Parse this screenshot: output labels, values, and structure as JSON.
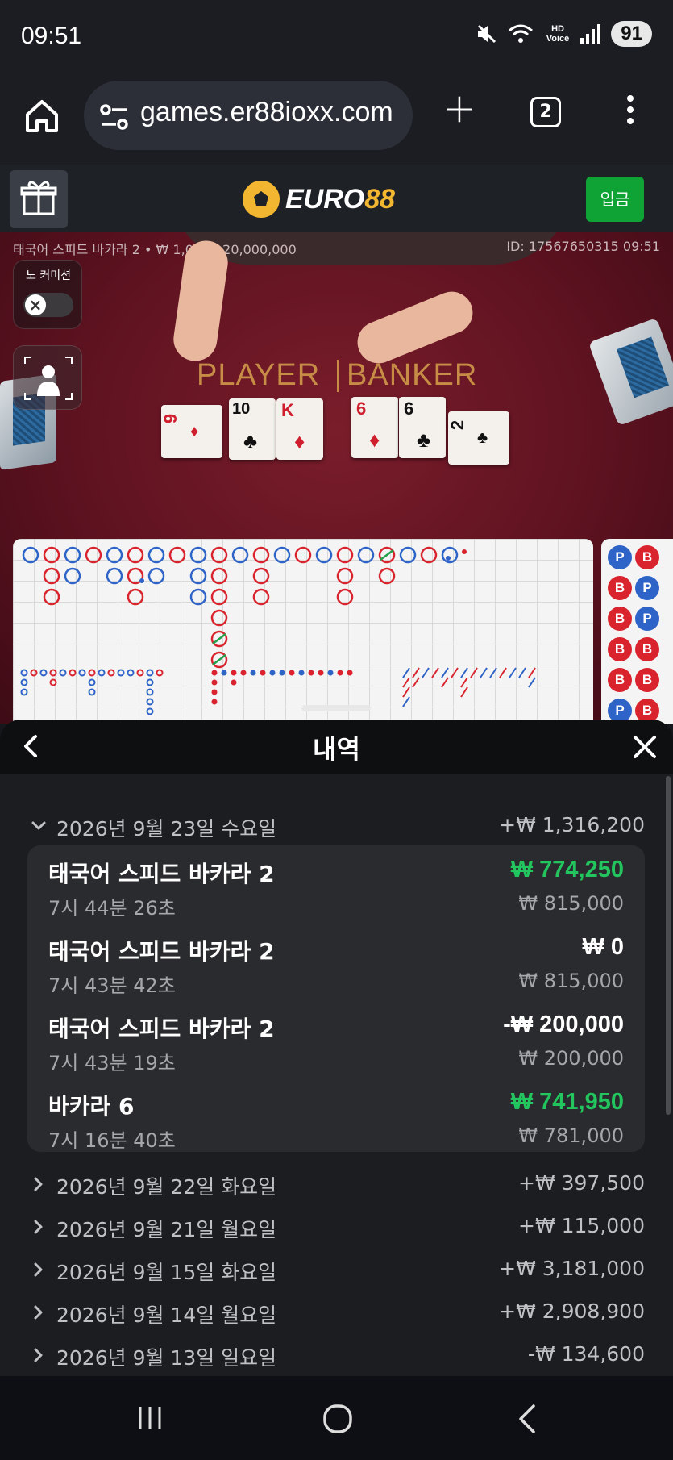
{
  "status_bar": {
    "time": "09:51",
    "battery": "91",
    "icons": [
      "mute-icon",
      "wifi-5g-icon",
      "hd-voice-icon",
      "signal-icon",
      "battery-icon"
    ],
    "hd_label": "HD",
    "voice_label": "Voice"
  },
  "browser": {
    "url": "games.er88ioxx.com",
    "tab_count": "2"
  },
  "site": {
    "logo_word": "EURO",
    "logo_num": "88",
    "deposit_label": "입금",
    "deposit_color": "#0fa336"
  },
  "game": {
    "info": "태국어 스피드 바카라 2 • ₩ 1,000 - 20,000,000",
    "id": "ID: 17567650315 09:51",
    "no_commission_label": "노 커미션",
    "player_label": "PLAYER",
    "banker_label": "BANKER",
    "player_cards": [
      {
        "rank": "9",
        "suit": "♦"
      },
      {
        "rank": "10",
        "suit": "♣"
      },
      {
        "rank": "K",
        "suit": "♦"
      }
    ],
    "banker_cards": [
      {
        "rank": "6",
        "suit": "♦"
      },
      {
        "rank": "6",
        "suit": "♣"
      },
      {
        "rank": "2",
        "suit": "♣"
      }
    ],
    "bead_road": [
      "P",
      "B",
      "B",
      "P",
      "B",
      "P",
      "B",
      "B",
      "B",
      "B",
      "P",
      "B"
    ]
  },
  "history": {
    "title": "내역",
    "expanded_day": {
      "date": "2026년 9월 23일 수요일",
      "total": "+₩ 1,316,200",
      "transactions": [
        {
          "game": "태국어 스피드 바카라 2",
          "time": "7시 44분 26초",
          "amount": "₩ 774,250",
          "stake": "₩ 815,000",
          "kind": "win"
        },
        {
          "game": "태국어 스피드 바카라 2",
          "time": "7시 43분 42초",
          "amount": "₩ 0",
          "stake": "₩ 815,000",
          "kind": "neutral"
        },
        {
          "game": "태국어 스피드 바카라 2",
          "time": "7시 43분 19초",
          "amount": "-₩ 200,000",
          "stake": "₩ 200,000",
          "kind": "neutral"
        },
        {
          "game": "바카라 6",
          "time": "7시 16분 40초",
          "amount": "₩ 741,950",
          "stake": "₩ 781,000",
          "kind": "win"
        }
      ]
    },
    "collapsed_days": [
      {
        "date": "2026년 9월 22일 화요일",
        "total": "+₩ 397,500"
      },
      {
        "date": "2026년 9월 21일 월요일",
        "total": "+₩ 115,000"
      },
      {
        "date": "2026년 9월 15일 화요일",
        "total": "+₩ 3,181,000"
      },
      {
        "date": "2026년 9월 14일 월요일",
        "total": "+₩ 2,908,900"
      },
      {
        "date": "2026년 9월 13일 일요일",
        "total": "-₩ 134,600"
      }
    ],
    "win_color": "#22c55e"
  }
}
